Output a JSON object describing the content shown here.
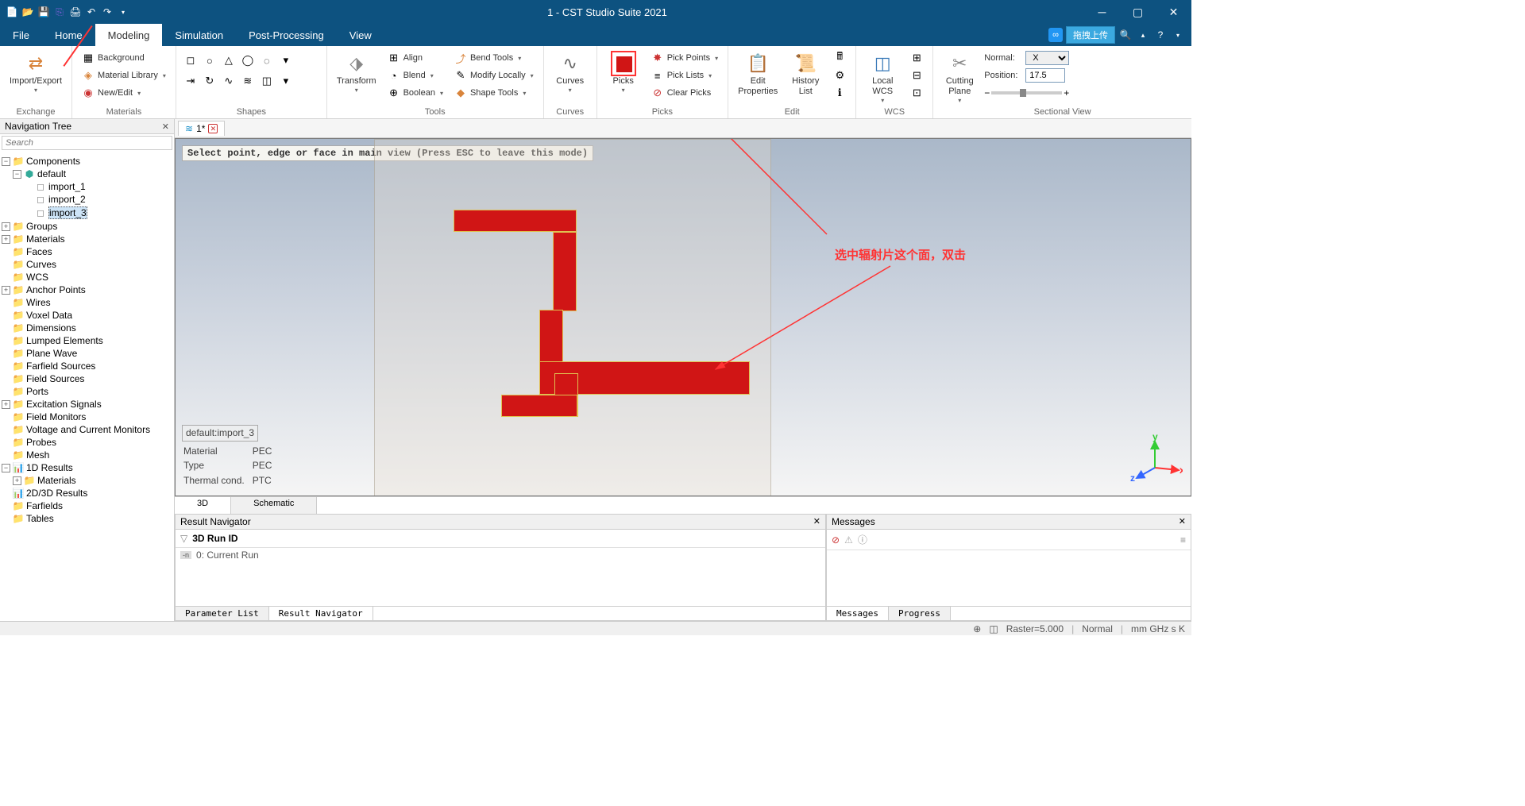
{
  "window": {
    "title": "1 - CST Studio Suite 2021"
  },
  "upload_btn": "拖拽上传",
  "menu": {
    "file": "File",
    "home": "Home",
    "modeling": "Modeling",
    "simulation": "Simulation",
    "post": "Post-Processing",
    "view": "View"
  },
  "ribbon": {
    "exchange": {
      "label": "Exchange",
      "import_export": "Import/Export"
    },
    "materials": {
      "label": "Materials",
      "background": "Background",
      "material_library": "Material Library",
      "new_edit": "New/Edit"
    },
    "shapes": {
      "label": "Shapes"
    },
    "tools": {
      "label": "Tools",
      "transform": "Transform",
      "align": "Align",
      "blend": "Blend",
      "boolean": "Boolean",
      "bend_tools": "Bend Tools",
      "modify_locally": "Modify Locally",
      "shape_tools": "Shape Tools"
    },
    "curves": {
      "label": "Curves",
      "curves": "Curves"
    },
    "picks": {
      "label": "Picks",
      "picks": "Picks",
      "pick_points": "Pick Points",
      "pick_lists": "Pick Lists",
      "clear_picks": "Clear Picks"
    },
    "edit": {
      "label": "Edit",
      "edit_properties": "Edit\nProperties",
      "history_list": "History\nList"
    },
    "wcs": {
      "label": "WCS",
      "local_wcs": "Local\nWCS"
    },
    "sectional": {
      "label": "Sectional View",
      "cutting_plane": "Cutting\nPlane",
      "normal_lbl": "Normal:",
      "normal_val": "X",
      "position_lbl": "Position:",
      "position_val": "17.5"
    }
  },
  "nav": {
    "title": "Navigation Tree",
    "search_placeholder": "Search",
    "items": {
      "components": "Components",
      "default": "default",
      "import_1": "import_1",
      "import_2": "import_2",
      "import_3": "import_3",
      "groups": "Groups",
      "materials": "Materials",
      "faces": "Faces",
      "curves": "Curves",
      "wcs": "WCS",
      "anchor_points": "Anchor Points",
      "wires": "Wires",
      "voxel_data": "Voxel Data",
      "dimensions": "Dimensions",
      "lumped_elements": "Lumped Elements",
      "plane_wave": "Plane Wave",
      "farfield_sources": "Farfield Sources",
      "field_sources": "Field Sources",
      "ports": "Ports",
      "excitation_signals": "Excitation Signals",
      "field_monitors": "Field Monitors",
      "voltage_current": "Voltage and Current Monitors",
      "probes": "Probes",
      "mesh": "Mesh",
      "results_1d": "1D Results",
      "materials_sub": "Materials",
      "results_2d3d": "2D/3D Results",
      "farfields": "Farfields",
      "tables": "Tables"
    }
  },
  "doc_tab": "1*",
  "viewport": {
    "status_msg": "Select point, edge or face in main view (Press ESC to leave this mode)",
    "info": {
      "name": "default:import_3",
      "material_lbl": "Material",
      "material_val": "PEC",
      "type_lbl": "Type",
      "type_val": "PEC",
      "thermal_lbl": "Thermal cond.",
      "thermal_val": "PTC"
    },
    "annotation_text": "选中辐射片这个面，双击"
  },
  "view_tabs": {
    "three_d": "3D",
    "schematic": "Schematic"
  },
  "result_nav": {
    "title": "Result Navigator",
    "header": "3D Run ID",
    "row0": "0: Current Run"
  },
  "messages": {
    "title": "Messages"
  },
  "bottom_tabs": {
    "param_list": "Parameter List",
    "result_nav": "Result Navigator",
    "messages": "Messages",
    "progress": "Progress"
  },
  "statusbar": {
    "raster": "Raster=5.000",
    "normal": "Normal",
    "units": "mm  GHz  s  K"
  }
}
